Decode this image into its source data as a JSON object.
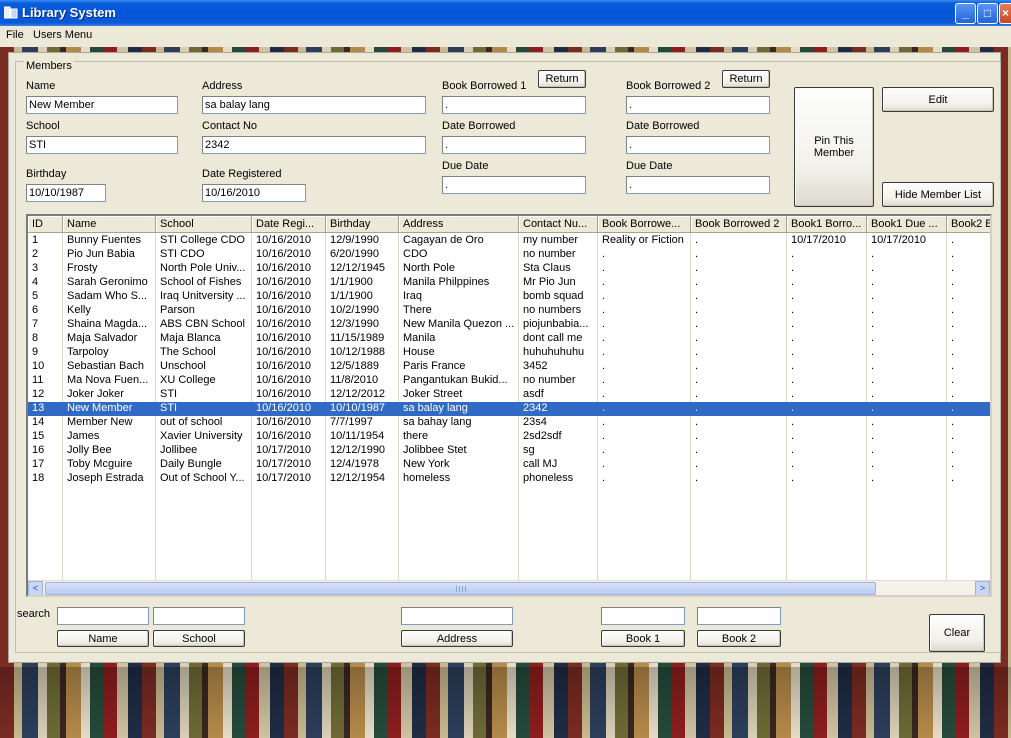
{
  "window": {
    "title": "Library System",
    "controls": {
      "minimize": "_",
      "maximize": "□",
      "close": "×"
    }
  },
  "menu": {
    "file": "File",
    "users": "Users Menu"
  },
  "members": {
    "group_label": "Members",
    "labels": {
      "name": "Name",
      "address": "Address",
      "book1": "Book Borrowed 1",
      "book2": "Book Borrowed 2",
      "school": "School",
      "contact": "Contact No",
      "date_borrowed_1": "Date Borrowed",
      "date_borrowed_2": "Date Borrowed",
      "birthday": "Birthday",
      "date_registered": "Date Registered",
      "due_date_1": "Due Date",
      "due_date_2": "Due Date"
    },
    "values": {
      "name": "New Member",
      "address": "sa balay lang",
      "book1": ".",
      "book2": ".",
      "school": "STI",
      "contact": "2342",
      "date_borrowed_1": ".",
      "date_borrowed_2": ".",
      "birthday": "10/10/1987",
      "date_registered": "10/16/2010",
      "due_date_1": ".",
      "due_date_2": "."
    },
    "buttons": {
      "return1": "Return",
      "return2": "Return",
      "pin": "Pin This Member",
      "edit": "Edit",
      "hide_list": "Hide Member List"
    }
  },
  "table": {
    "columns": [
      "ID",
      "Name",
      "School",
      "Date Regi...",
      "Birthday",
      "Address",
      "Contact Nu...",
      "Book Borrowe...",
      "Book Borrowed 2",
      "Book1 Borro...",
      "Book1 Due ...",
      "Book2 B"
    ],
    "selected_index": 12,
    "rows": [
      [
        "1",
        "Bunny Fuentes",
        "STI College CDO",
        "10/16/2010",
        "12/9/1990",
        "Cagayan de Oro",
        "my number",
        "Reality or Fiction",
        ".",
        "10/17/2010",
        "10/17/2010",
        "."
      ],
      [
        "2",
        "Pio Jun Babia",
        "STI CDO",
        "10/16/2010",
        "6/20/1990",
        "CDO",
        "no number",
        ".",
        ".",
        ".",
        ".",
        "."
      ],
      [
        "3",
        "Frosty",
        "North Pole Univ...",
        "10/16/2010",
        "12/12/1945",
        "North Pole",
        "Sta Claus",
        ".",
        ".",
        ".",
        ".",
        "."
      ],
      [
        "4",
        "Sarah Geronimo",
        "School of Fishes",
        "10/16/2010",
        "1/1/1900",
        "Manila Philppines",
        "Mr Pio Jun",
        ".",
        ".",
        ".",
        ".",
        "."
      ],
      [
        "5",
        "Sadam Who S...",
        "Iraq Unitversity ...",
        "10/16/2010",
        "1/1/1900",
        "Iraq",
        "bomb squad",
        ".",
        ".",
        ".",
        ".",
        "."
      ],
      [
        "6",
        "Kelly",
        "Parson",
        "10/16/2010",
        "10/2/1990",
        "There",
        "no numbers",
        ".",
        ".",
        ".",
        ".",
        "."
      ],
      [
        "7",
        "Shaina Magda...",
        "ABS CBN School",
        "10/16/2010",
        "12/3/1990",
        "New Manila Quezon ...",
        "piojunbabia...",
        ".",
        ".",
        ".",
        ".",
        "."
      ],
      [
        "8",
        "Maja Salvador",
        "Maja Blanca",
        "10/16/2010",
        "11/15/1989",
        "Manila",
        "dont call me",
        ".",
        ".",
        ".",
        ".",
        "."
      ],
      [
        "9",
        "Tarpoloy",
        "The School",
        "10/16/2010",
        "10/12/1988",
        "House",
        "huhuhuhuhu",
        ".",
        ".",
        ".",
        ".",
        "."
      ],
      [
        "10",
        "Sebastian Bach",
        "Unschool",
        "10/16/2010",
        "12/5/1889",
        "Paris France",
        "3452",
        ".",
        ".",
        ".",
        ".",
        "."
      ],
      [
        "11",
        "Ma Nova Fuen...",
        "XU College",
        "10/16/2010",
        "11/8/2010",
        "Pangantukan Bukid...",
        "no number",
        ".",
        ".",
        ".",
        ".",
        "."
      ],
      [
        "12",
        "Joker Joker",
        "STI",
        "10/16/2010",
        "12/12/2012",
        "Joker Street",
        "asdf",
        ".",
        ".",
        ".",
        ".",
        "."
      ],
      [
        "13",
        "New Member",
        "STI",
        "10/16/2010",
        "10/10/1987",
        "sa balay lang",
        "2342",
        ".",
        ".",
        ".",
        ".",
        "."
      ],
      [
        "14",
        "Member New",
        "out of school",
        "10/16/2010",
        "7/7/1997",
        "sa bahay lang",
        "23s4",
        ".",
        ".",
        ".",
        ".",
        "."
      ],
      [
        "15",
        "James",
        "Xavier University",
        "10/16/2010",
        "10/11/1954",
        "there",
        "2sd2sdf",
        ".",
        ".",
        ".",
        ".",
        "."
      ],
      [
        "16",
        "Jolly Bee",
        "Jollibee",
        "10/17/2010",
        "12/12/1990",
        "Jolibbee Stet",
        "sg",
        ".",
        ".",
        ".",
        ".",
        "."
      ],
      [
        "17",
        "Toby Mcguire",
        "Daily Bungle",
        "10/17/2010",
        "12/4/1978",
        "New York",
        "call MJ",
        ".",
        ".",
        ".",
        ".",
        "."
      ],
      [
        "18",
        "Joseph Estrada",
        "Out of School Y...",
        "10/17/2010",
        "12/12/1954",
        "homeless",
        "phoneless",
        ".",
        ".",
        ".",
        ".",
        "."
      ]
    ],
    "scroll": {
      "left_arrow": "<",
      "right_arrow": ">"
    }
  },
  "search": {
    "label": "search",
    "name_value": "",
    "school_value": "",
    "address_value": "",
    "book1_value": "",
    "book2_value": "",
    "buttons": {
      "name": "Name",
      "school": "School",
      "address": "Address",
      "book1": "Book 1",
      "book2": "Book 2",
      "clear": "Clear"
    }
  },
  "colors": {
    "titlebar": "#0454d6",
    "form_bg": "#ece9d8",
    "selection": "#316ac5"
  }
}
